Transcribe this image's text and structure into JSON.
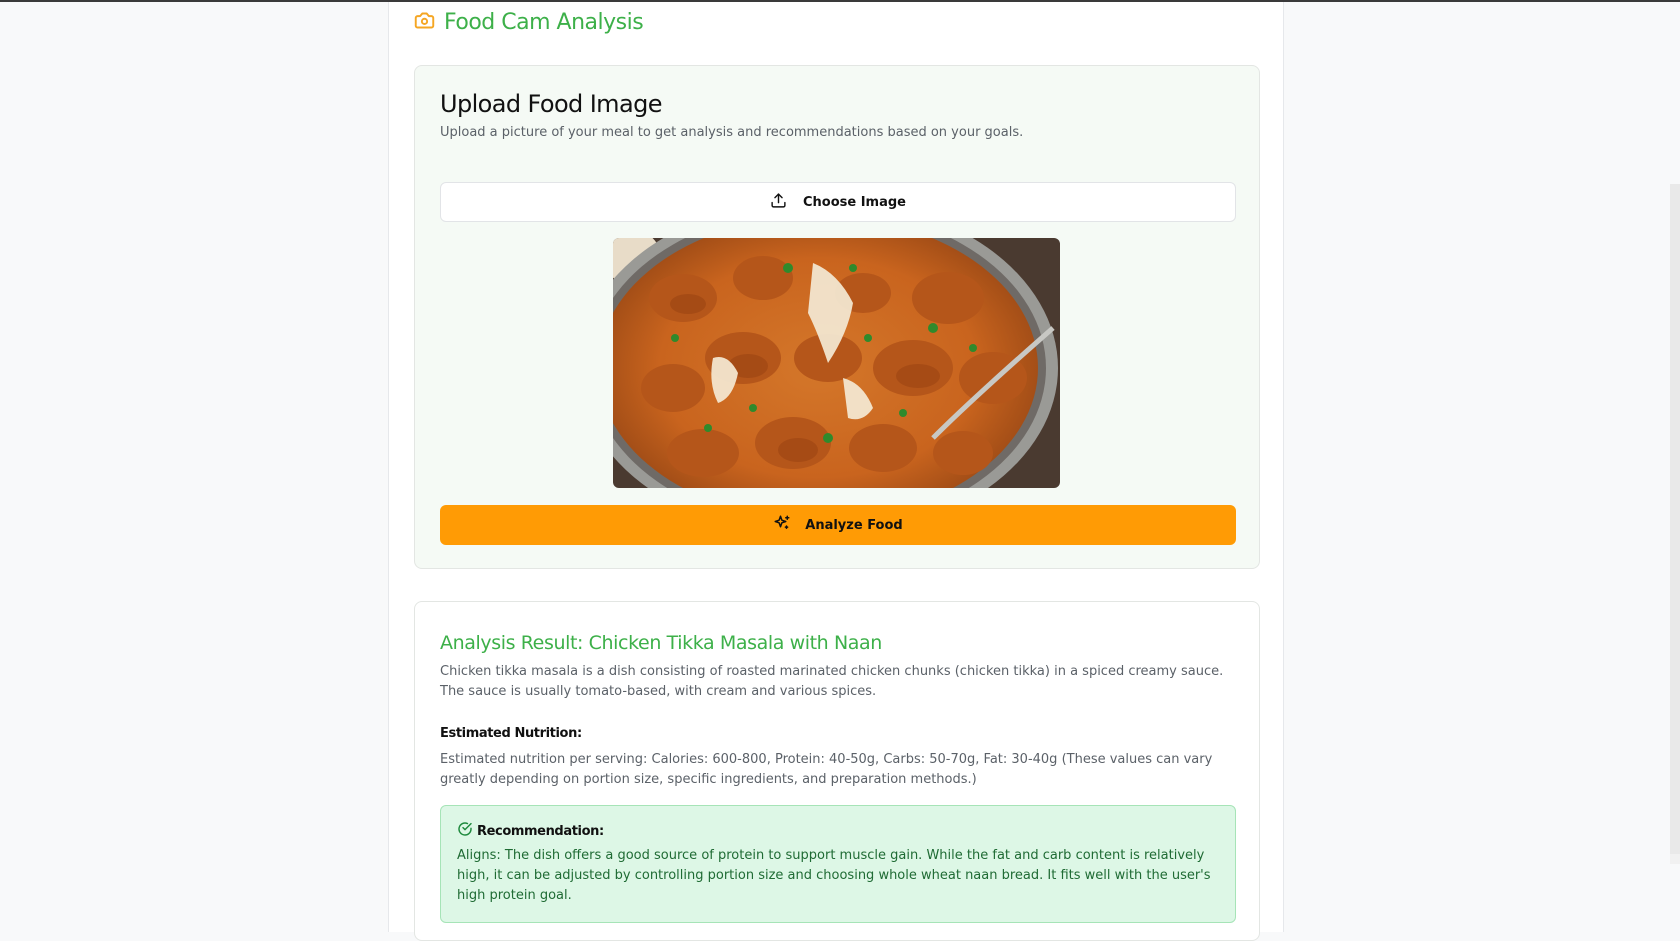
{
  "app": {
    "title": "Food Cam Analysis",
    "title_icon": "camera-icon",
    "accent_color": "#3db049",
    "icon_color": "#f5a623"
  },
  "upload": {
    "title": "Upload Food Image",
    "subtitle": "Upload a picture of your meal to get analysis and recommendations based on your goals.",
    "choose_label": "Choose Image",
    "choose_icon": "upload-icon",
    "image_icon": "food-photo",
    "analyze_label": "Analyze Food",
    "analyze_icon": "sparkles-icon",
    "analyze_color": "#ff9b05"
  },
  "result": {
    "title": "Analysis Result: Chicken Tikka Masala with Naan",
    "description": "Chicken tikka masala is a dish consisting of roasted marinated chicken chunks (chicken tikka) in a spiced creamy sauce. The sauce is usually tomato-based, with cream and various spices.",
    "nutrition_label": "Estimated Nutrition:",
    "nutrition_text": "Estimated nutrition per serving: Calories: 600-800, Protein: 40-50g, Carbs: 50-70g, Fat: 30-40g (These values can vary greatly depending on portion size, specific ingredients, and preparation methods.)",
    "recommendation_label": "Recommendation:",
    "recommendation_icon": "check-circle-icon",
    "recommendation_text": "Aligns: The dish offers a good source of protein to support muscle gain. While the fat and carb content is relatively high, it can be adjusted by controlling portion size and choosing whole wheat naan bread. It fits well with the user's high protein goal.",
    "recommendation_color": "#1f6b34"
  }
}
